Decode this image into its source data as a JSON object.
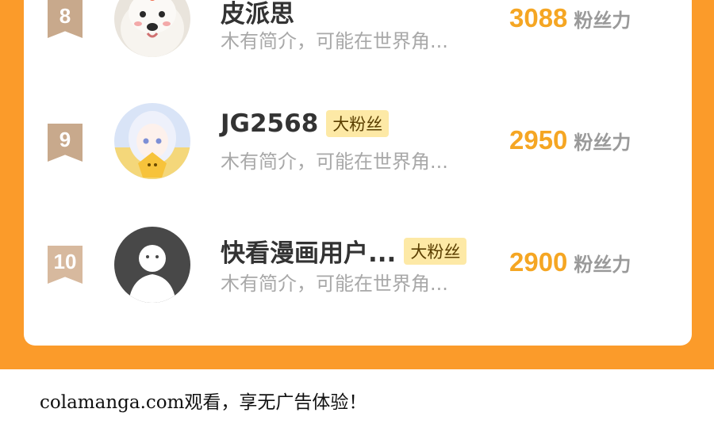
{
  "rows": [
    {
      "rank": "8",
      "name": "皮派思",
      "badge": "",
      "bio": "木有简介，可能在世界角...",
      "score": "3088",
      "score_unit": "粉丝力",
      "rank_color": "#c8a98c",
      "avatar": "dog-photo"
    },
    {
      "rank": "9",
      "name": "JG2568",
      "badge": "大粉丝",
      "bio": "木有简介，可能在世界角...",
      "score": "2950",
      "score_unit": "粉丝力",
      "rank_color": "#c8a98c",
      "avatar": "anime-girl-avatar"
    },
    {
      "rank": "10",
      "name": "快看漫画用户...",
      "badge": "大粉丝",
      "bio": "木有简介，可能在世界角...",
      "score": "2900",
      "score_unit": "粉丝力",
      "rank_color": "#d7b99e",
      "avatar": "default-user-avatar"
    }
  ],
  "watermark": "colamanga.com观看，享无广告体验！",
  "colors": {
    "frame": "#fb9b2a",
    "score": "#f5a623",
    "badge_bg": "#fde9a6"
  }
}
